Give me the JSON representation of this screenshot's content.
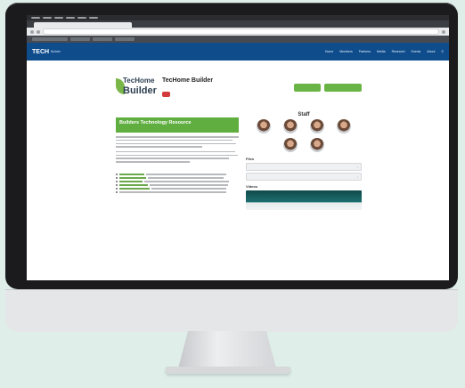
{
  "browser": {
    "tab_title": "TecHome Builder",
    "url": ""
  },
  "site": {
    "logo_title": "TECH",
    "logo_sub": "Builder",
    "nav": [
      "Home",
      "Members",
      "Partners",
      "Media",
      "Research",
      "Events",
      "About"
    ]
  },
  "page": {
    "logo_line1": "TecHome",
    "logo_line2": "Builder",
    "title": "TecHome Builder",
    "badge": "",
    "button1": "",
    "button2": ""
  },
  "left": {
    "breadcrumb": "",
    "banner_title": "Builders Technology Resource",
    "banner_sub": ""
  },
  "staff": {
    "heading": "Staff",
    "people": [
      {
        "name": ""
      },
      {
        "name": ""
      },
      {
        "name": ""
      },
      {
        "name": ""
      },
      {
        "name": ""
      },
      {
        "name": ""
      }
    ]
  },
  "files": {
    "heading": "Files",
    "items": [
      {
        "label": ""
      },
      {
        "label": ""
      }
    ]
  },
  "videos": {
    "heading": "Videos"
  },
  "colors": {
    "nav_blue": "#0e4c8c",
    "accent_green": "#69b445",
    "badge_red": "#d23b3b"
  }
}
